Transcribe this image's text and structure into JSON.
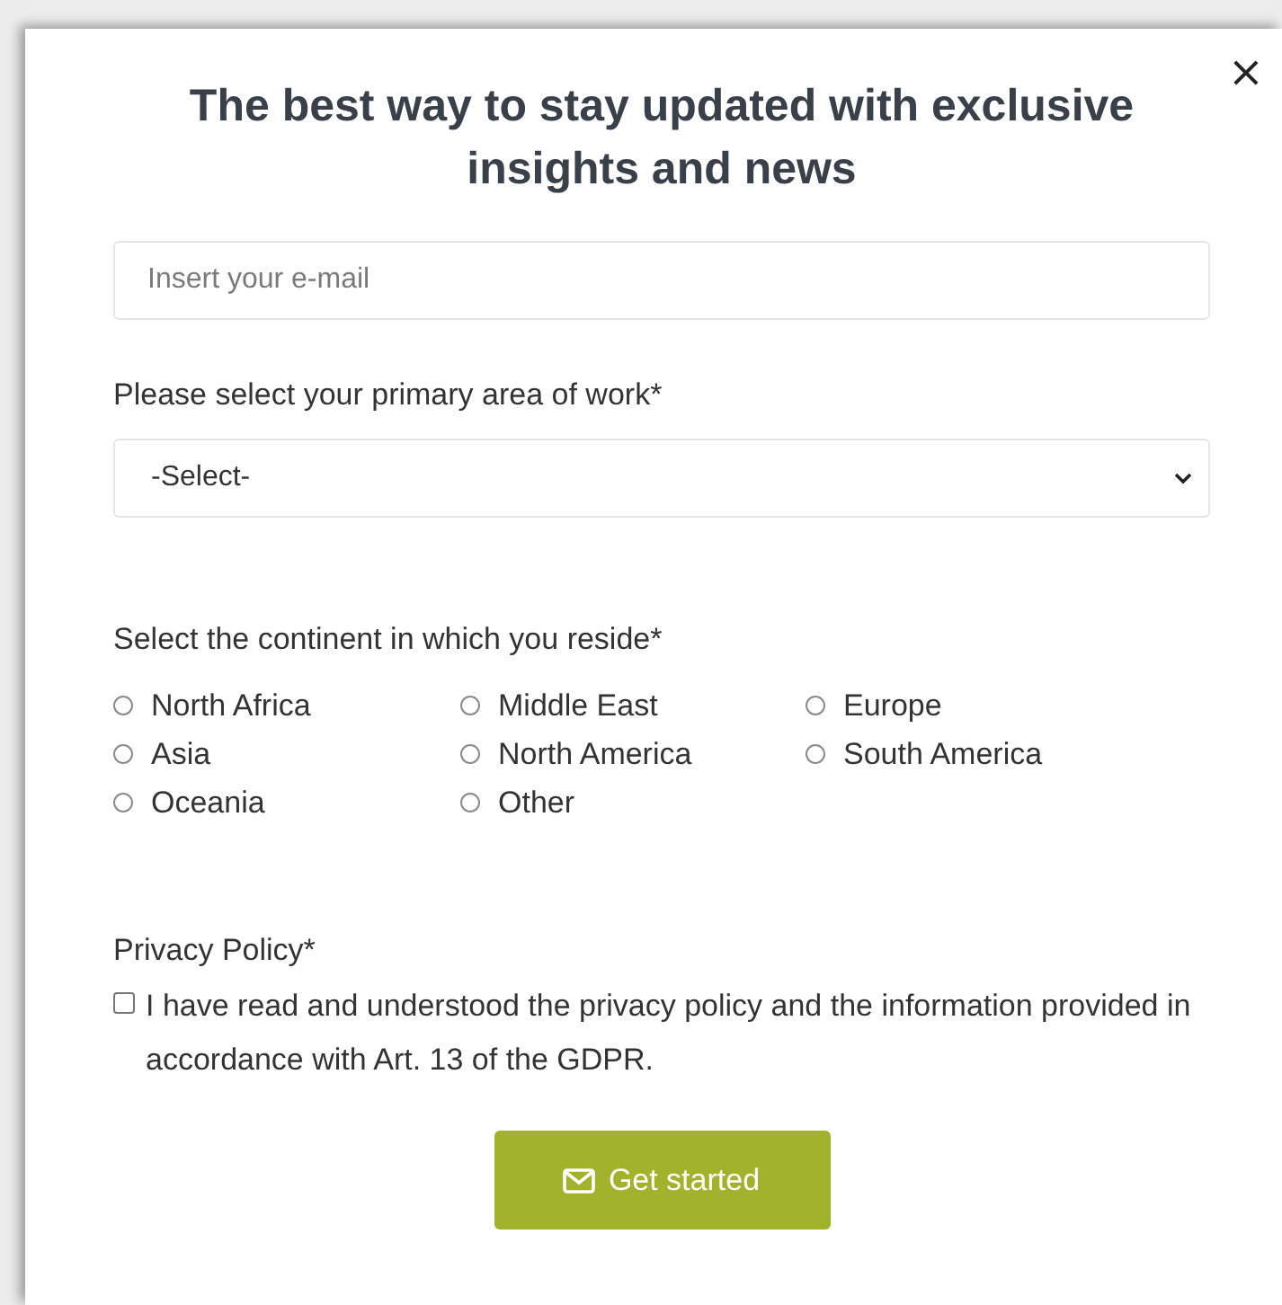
{
  "dialog": {
    "close": "×",
    "title": "The best way to stay updated with exclusive insights and news"
  },
  "email": {
    "placeholder": "Insert your e-mail"
  },
  "area_of_work": {
    "label": "Please select your primary area of work*",
    "value": "-Select-"
  },
  "continent": {
    "label": "Select the continent in which you reside*",
    "options": [
      {
        "label": "North Africa",
        "selected": false
      },
      {
        "label": "Middle East",
        "selected": false
      },
      {
        "label": "Europe",
        "selected": false
      },
      {
        "label": "Asia",
        "selected": false
      },
      {
        "label": "North America",
        "selected": false
      },
      {
        "label": "South America",
        "selected": false
      },
      {
        "label": "Oceania",
        "selected": false
      },
      {
        "label": "Other",
        "selected": false
      }
    ]
  },
  "privacy": {
    "label": "Privacy Policy*",
    "consent": "I have read and understood the privacy policy and the information provided in accordance with Art. 13 of the GDPR.",
    "checked": false
  },
  "submit": {
    "label": "Get started"
  }
}
